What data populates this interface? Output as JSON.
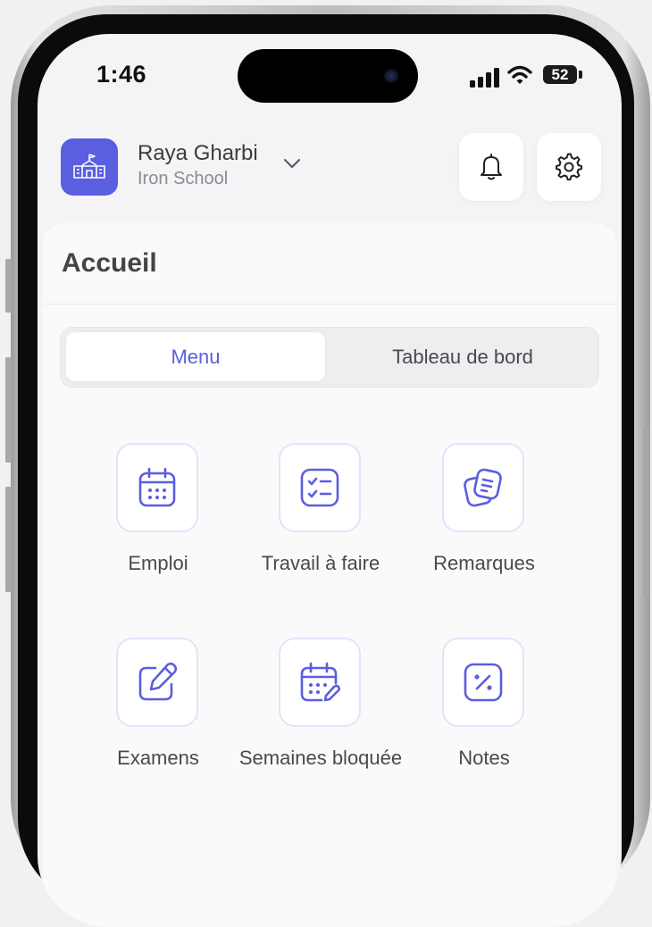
{
  "status_bar": {
    "time": "1:46",
    "battery_level": "52",
    "icons": [
      "cellular-signal-icon",
      "wifi-icon",
      "battery-icon"
    ]
  },
  "header": {
    "user_name": "Raya Gharbi",
    "school_name": "Iron School",
    "icons": [
      "school-logo-icon",
      "chevron-down-icon",
      "bell-icon",
      "gear-icon"
    ]
  },
  "page": {
    "title": "Accueil"
  },
  "tabs": {
    "items": [
      {
        "label": "Menu",
        "active": true
      },
      {
        "label": "Tableau de bord",
        "active": false
      }
    ]
  },
  "menu": {
    "items": [
      {
        "label": "Emploi",
        "icon": "calendar-icon"
      },
      {
        "label": "Travail à faire",
        "icon": "checklist-icon"
      },
      {
        "label": "Remarques",
        "icon": "notes-stack-icon"
      },
      {
        "label": "Examens",
        "icon": "edit-pen-icon"
      },
      {
        "label": "Semaines bloquée",
        "icon": "calendar-edit-icon"
      },
      {
        "label": "Notes",
        "icon": "percent-icon"
      }
    ]
  },
  "colors": {
    "accent": "#5a5ee0",
    "background": "#f4f4f6",
    "card": "#fafafb",
    "text_primary": "#3c3c3f",
    "text_secondary": "#8b8b90"
  }
}
